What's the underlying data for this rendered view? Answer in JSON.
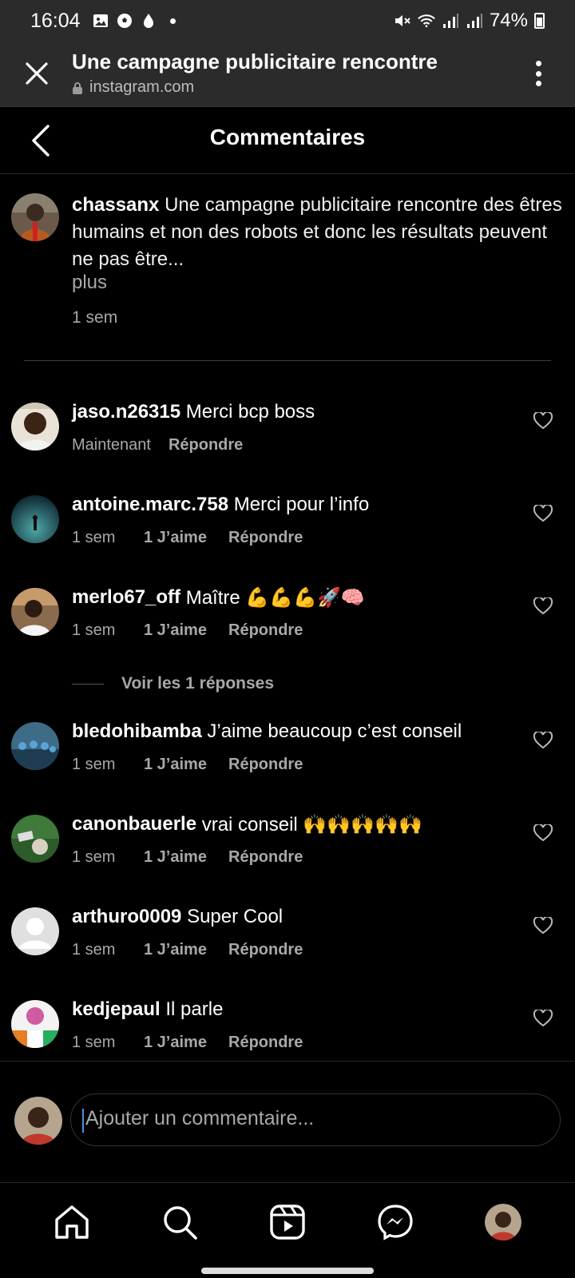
{
  "status_bar": {
    "time": "16:04",
    "battery": "74%"
  },
  "browser": {
    "title": "Une campagne publicitaire rencontre",
    "url": "instagram.com"
  },
  "header": {
    "title": "Commentaires"
  },
  "caption": {
    "username": "chassanx",
    "text": "Une campagne publicitaire rencontre des êtres humains et non des robots et donc les résultats peuvent ne pas être...",
    "more": "plus",
    "time": "1 sem"
  },
  "comments": [
    {
      "username": "jaso.n26315",
      "text": "Merci bcp boss",
      "time": "Maintenant",
      "likes": "",
      "reply": "Répondre"
    },
    {
      "username": "antoine.marc.758",
      "text": "Merci pour l’info",
      "time": "1 sem",
      "likes": "1 J’aime",
      "reply": "Répondre"
    },
    {
      "username": "merlo67_off",
      "text": "Maître 💪💪💪🚀🧠",
      "time": "1 sem",
      "likes": "1 J’aime",
      "reply": "Répondre"
    },
    {
      "username": "bledohibamba",
      "text": "J’aime beaucoup c’est conseil",
      "time": "1 sem",
      "likes": "1 J’aime",
      "reply": "Répondre"
    },
    {
      "username": "canonbauerle",
      "text": "vrai conseil 🙌🙌🙌🙌🙌",
      "time": "1 sem",
      "likes": "1 J’aime",
      "reply": "Répondre"
    },
    {
      "username": "arthuro0009",
      "text": "Super Cool",
      "time": "1 sem",
      "likes": "1 J’aime",
      "reply": "Répondre"
    },
    {
      "username": "kedjepaul",
      "text": "Il parle",
      "time": "1 sem",
      "likes": "1 J’aime",
      "reply": "Répondre"
    }
  ],
  "view_replies": "Voir les 1 réponses",
  "composer": {
    "placeholder": "Ajouter un commentaire..."
  },
  "bottom_nav": [
    "home-icon",
    "search-icon",
    "reels-icon",
    "messenger-icon",
    "profile-avatar"
  ],
  "colors": {
    "background": "#000000",
    "secondary_text": "#a8a8a8",
    "bars": "#2b2b2b"
  }
}
